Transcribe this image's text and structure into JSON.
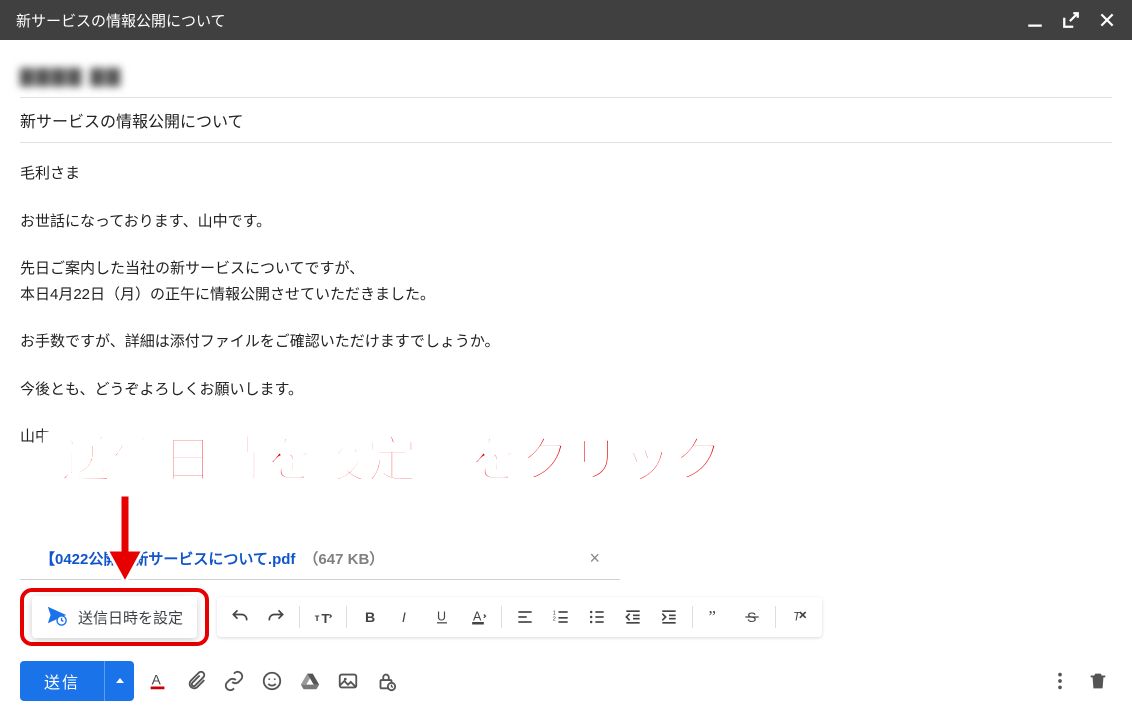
{
  "titlebar": {
    "title": "新サービスの情報公開について"
  },
  "recipient_blur": "▇▇▇▇ ▇▇",
  "subject": "新サービスの情報公開について",
  "body": {
    "p1": "毛利さま",
    "p2": "お世話になっております、山中です。",
    "p3a": "先日ご案内した当社の新サービスについてですが、",
    "p3b": "本日4月22日（月）の正午に情報公開させていただきました。",
    "p4": "お手数ですが、詳細は添付ファイルをご確認いただけますでしょうか。",
    "p5": "今後とも、どうぞよろしくお願いします。",
    "p6": "山中"
  },
  "attachment": {
    "name": "【0422公開】新サービスについて.pdf",
    "size": "（647 KB）"
  },
  "schedule_popover": "送信日時を設定",
  "actions": {
    "send": "送信"
  },
  "annotation_text": "［送信日時を設定］をクリック"
}
